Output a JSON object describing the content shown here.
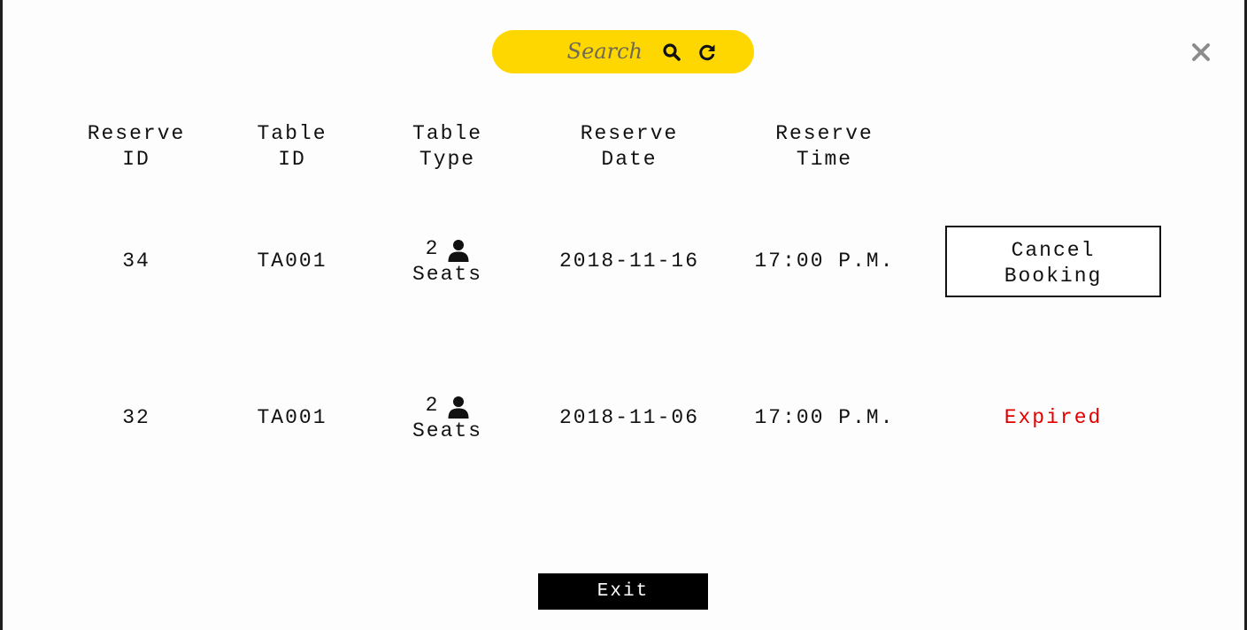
{
  "search": {
    "placeholder": "Search",
    "search_icon": "magnifier-icon",
    "refresh_icon": "refresh-icon",
    "accent_color": "#ffd700"
  },
  "close_icon": "close-x-icon",
  "table": {
    "headers": [
      {
        "line1": "Reserve",
        "line2": "ID"
      },
      {
        "line1": "Table",
        "line2": "ID"
      },
      {
        "line1": "Table",
        "line2": "Type"
      },
      {
        "line1": "Reserve",
        "line2": "Date"
      },
      {
        "line1": "Reserve",
        "line2": "Time"
      }
    ],
    "rows": [
      {
        "reserve_id": "34",
        "table_id": "TA001",
        "seats_count": "2",
        "seats_label": "Seats",
        "date": "2018-11-16",
        "time": "17:00 P.M.",
        "action_label": "Cancel\nBooking"
      },
      {
        "reserve_id": "32",
        "table_id": "TA001",
        "seats_count": "2",
        "seats_label": "Seats",
        "date": "2018-11-06",
        "time": "17:00 P.M.",
        "status_label": "Expired",
        "status_color": "#e00000"
      }
    ]
  },
  "exit_label": "Exit"
}
